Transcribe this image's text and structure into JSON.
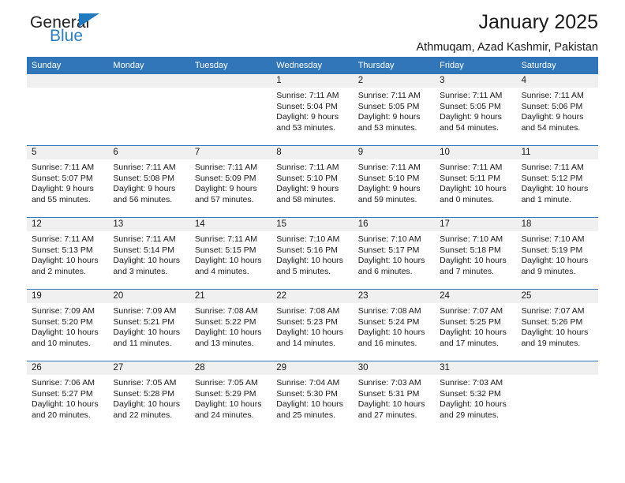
{
  "logo": {
    "word1": "General",
    "word2": "Blue",
    "accent_color": "#2a7fc4"
  },
  "header": {
    "title": "January 2025",
    "subtitle": "Athmuqam, Azad Kashmir, Pakistan"
  },
  "theme": {
    "header_bg": "#3076b8",
    "daynum_bg": "#f0f0f0",
    "text": "#1a1a1a"
  },
  "weekdays": [
    "Sunday",
    "Monday",
    "Tuesday",
    "Wednesday",
    "Thursday",
    "Friday",
    "Saturday"
  ],
  "weeks": [
    [
      {
        "day": "",
        "empty": true
      },
      {
        "day": "",
        "empty": true
      },
      {
        "day": "",
        "empty": true
      },
      {
        "day": "1",
        "sunrise": "Sunrise: 7:11 AM",
        "sunset": "Sunset: 5:04 PM",
        "daylight1": "Daylight: 9 hours",
        "daylight2": "and 53 minutes."
      },
      {
        "day": "2",
        "sunrise": "Sunrise: 7:11 AM",
        "sunset": "Sunset: 5:05 PM",
        "daylight1": "Daylight: 9 hours",
        "daylight2": "and 53 minutes."
      },
      {
        "day": "3",
        "sunrise": "Sunrise: 7:11 AM",
        "sunset": "Sunset: 5:05 PM",
        "daylight1": "Daylight: 9 hours",
        "daylight2": "and 54 minutes."
      },
      {
        "day": "4",
        "sunrise": "Sunrise: 7:11 AM",
        "sunset": "Sunset: 5:06 PM",
        "daylight1": "Daylight: 9 hours",
        "daylight2": "and 54 minutes."
      }
    ],
    [
      {
        "day": "5",
        "sunrise": "Sunrise: 7:11 AM",
        "sunset": "Sunset: 5:07 PM",
        "daylight1": "Daylight: 9 hours",
        "daylight2": "and 55 minutes."
      },
      {
        "day": "6",
        "sunrise": "Sunrise: 7:11 AM",
        "sunset": "Sunset: 5:08 PM",
        "daylight1": "Daylight: 9 hours",
        "daylight2": "and 56 minutes."
      },
      {
        "day": "7",
        "sunrise": "Sunrise: 7:11 AM",
        "sunset": "Sunset: 5:09 PM",
        "daylight1": "Daylight: 9 hours",
        "daylight2": "and 57 minutes."
      },
      {
        "day": "8",
        "sunrise": "Sunrise: 7:11 AM",
        "sunset": "Sunset: 5:10 PM",
        "daylight1": "Daylight: 9 hours",
        "daylight2": "and 58 minutes."
      },
      {
        "day": "9",
        "sunrise": "Sunrise: 7:11 AM",
        "sunset": "Sunset: 5:10 PM",
        "daylight1": "Daylight: 9 hours",
        "daylight2": "and 59 minutes."
      },
      {
        "day": "10",
        "sunrise": "Sunrise: 7:11 AM",
        "sunset": "Sunset: 5:11 PM",
        "daylight1": "Daylight: 10 hours",
        "daylight2": "and 0 minutes."
      },
      {
        "day": "11",
        "sunrise": "Sunrise: 7:11 AM",
        "sunset": "Sunset: 5:12 PM",
        "daylight1": "Daylight: 10 hours",
        "daylight2": "and 1 minute."
      }
    ],
    [
      {
        "day": "12",
        "sunrise": "Sunrise: 7:11 AM",
        "sunset": "Sunset: 5:13 PM",
        "daylight1": "Daylight: 10 hours",
        "daylight2": "and 2 minutes."
      },
      {
        "day": "13",
        "sunrise": "Sunrise: 7:11 AM",
        "sunset": "Sunset: 5:14 PM",
        "daylight1": "Daylight: 10 hours",
        "daylight2": "and 3 minutes."
      },
      {
        "day": "14",
        "sunrise": "Sunrise: 7:11 AM",
        "sunset": "Sunset: 5:15 PM",
        "daylight1": "Daylight: 10 hours",
        "daylight2": "and 4 minutes."
      },
      {
        "day": "15",
        "sunrise": "Sunrise: 7:10 AM",
        "sunset": "Sunset: 5:16 PM",
        "daylight1": "Daylight: 10 hours",
        "daylight2": "and 5 minutes."
      },
      {
        "day": "16",
        "sunrise": "Sunrise: 7:10 AM",
        "sunset": "Sunset: 5:17 PM",
        "daylight1": "Daylight: 10 hours",
        "daylight2": "and 6 minutes."
      },
      {
        "day": "17",
        "sunrise": "Sunrise: 7:10 AM",
        "sunset": "Sunset: 5:18 PM",
        "daylight1": "Daylight: 10 hours",
        "daylight2": "and 7 minutes."
      },
      {
        "day": "18",
        "sunrise": "Sunrise: 7:10 AM",
        "sunset": "Sunset: 5:19 PM",
        "daylight1": "Daylight: 10 hours",
        "daylight2": "and 9 minutes."
      }
    ],
    [
      {
        "day": "19",
        "sunrise": "Sunrise: 7:09 AM",
        "sunset": "Sunset: 5:20 PM",
        "daylight1": "Daylight: 10 hours",
        "daylight2": "and 10 minutes."
      },
      {
        "day": "20",
        "sunrise": "Sunrise: 7:09 AM",
        "sunset": "Sunset: 5:21 PM",
        "daylight1": "Daylight: 10 hours",
        "daylight2": "and 11 minutes."
      },
      {
        "day": "21",
        "sunrise": "Sunrise: 7:08 AM",
        "sunset": "Sunset: 5:22 PM",
        "daylight1": "Daylight: 10 hours",
        "daylight2": "and 13 minutes."
      },
      {
        "day": "22",
        "sunrise": "Sunrise: 7:08 AM",
        "sunset": "Sunset: 5:23 PM",
        "daylight1": "Daylight: 10 hours",
        "daylight2": "and 14 minutes."
      },
      {
        "day": "23",
        "sunrise": "Sunrise: 7:08 AM",
        "sunset": "Sunset: 5:24 PM",
        "daylight1": "Daylight: 10 hours",
        "daylight2": "and 16 minutes."
      },
      {
        "day": "24",
        "sunrise": "Sunrise: 7:07 AM",
        "sunset": "Sunset: 5:25 PM",
        "daylight1": "Daylight: 10 hours",
        "daylight2": "and 17 minutes."
      },
      {
        "day": "25",
        "sunrise": "Sunrise: 7:07 AM",
        "sunset": "Sunset: 5:26 PM",
        "daylight1": "Daylight: 10 hours",
        "daylight2": "and 19 minutes."
      }
    ],
    [
      {
        "day": "26",
        "sunrise": "Sunrise: 7:06 AM",
        "sunset": "Sunset: 5:27 PM",
        "daylight1": "Daylight: 10 hours",
        "daylight2": "and 20 minutes."
      },
      {
        "day": "27",
        "sunrise": "Sunrise: 7:05 AM",
        "sunset": "Sunset: 5:28 PM",
        "daylight1": "Daylight: 10 hours",
        "daylight2": "and 22 minutes."
      },
      {
        "day": "28",
        "sunrise": "Sunrise: 7:05 AM",
        "sunset": "Sunset: 5:29 PM",
        "daylight1": "Daylight: 10 hours",
        "daylight2": "and 24 minutes."
      },
      {
        "day": "29",
        "sunrise": "Sunrise: 7:04 AM",
        "sunset": "Sunset: 5:30 PM",
        "daylight1": "Daylight: 10 hours",
        "daylight2": "and 25 minutes."
      },
      {
        "day": "30",
        "sunrise": "Sunrise: 7:03 AM",
        "sunset": "Sunset: 5:31 PM",
        "daylight1": "Daylight: 10 hours",
        "daylight2": "and 27 minutes."
      },
      {
        "day": "31",
        "sunrise": "Sunrise: 7:03 AM",
        "sunset": "Sunset: 5:32 PM",
        "daylight1": "Daylight: 10 hours",
        "daylight2": "and 29 minutes."
      },
      {
        "day": "",
        "empty": true
      }
    ]
  ]
}
